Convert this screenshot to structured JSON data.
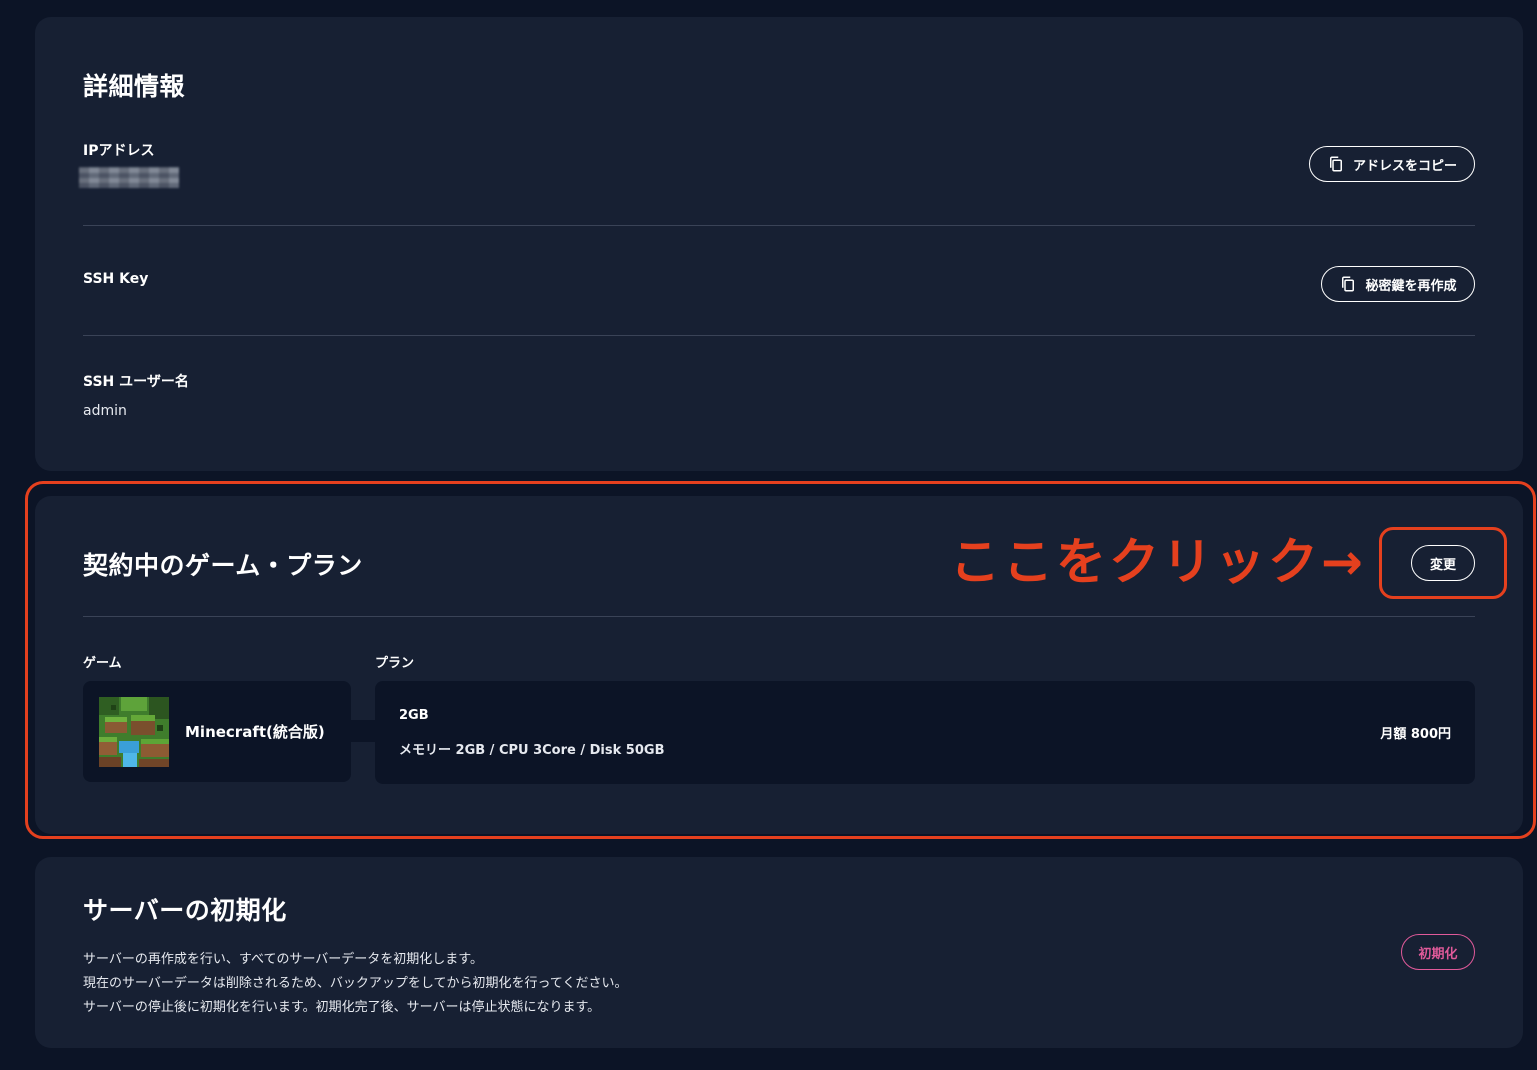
{
  "details": {
    "title": "詳細情報",
    "ip_label": "IPアドレス",
    "copy_address_label": "アドレスをコピー",
    "ssh_key_label": "SSH Key",
    "regen_key_label": "秘密鍵を再作成",
    "ssh_user_label": "SSH ユーザー名",
    "ssh_user_value": "admin"
  },
  "plan": {
    "title": "契約中のゲーム・プラン",
    "annotation": "ここをクリック→",
    "change_label": "変更",
    "game_label": "ゲーム",
    "plan_label": "プラン",
    "game_name": "Minecraft(統合版)",
    "plan_name": "2GB",
    "plan_spec": "メモリー 2GB / CPU 3Core / Disk 50GB",
    "plan_price": "月額 800円"
  },
  "reset": {
    "title": "サーバーの初期化",
    "lines": [
      "サーバーの再作成を行い、すべてのサーバーデータを初期化します。",
      "現在のサーバーデータは削除されるため、バックアップをしてから初期化を行ってください。",
      "サーバーの停止後に初期化を行います。初期化完了後、サーバーは停止状態になります。"
    ],
    "reset_label": "初期化"
  },
  "colors": {
    "background": "#0c1426",
    "card": "#172033",
    "annotation": "#e5401e",
    "danger": "#e05a9a"
  },
  "icons": [
    "copy-icon"
  ]
}
